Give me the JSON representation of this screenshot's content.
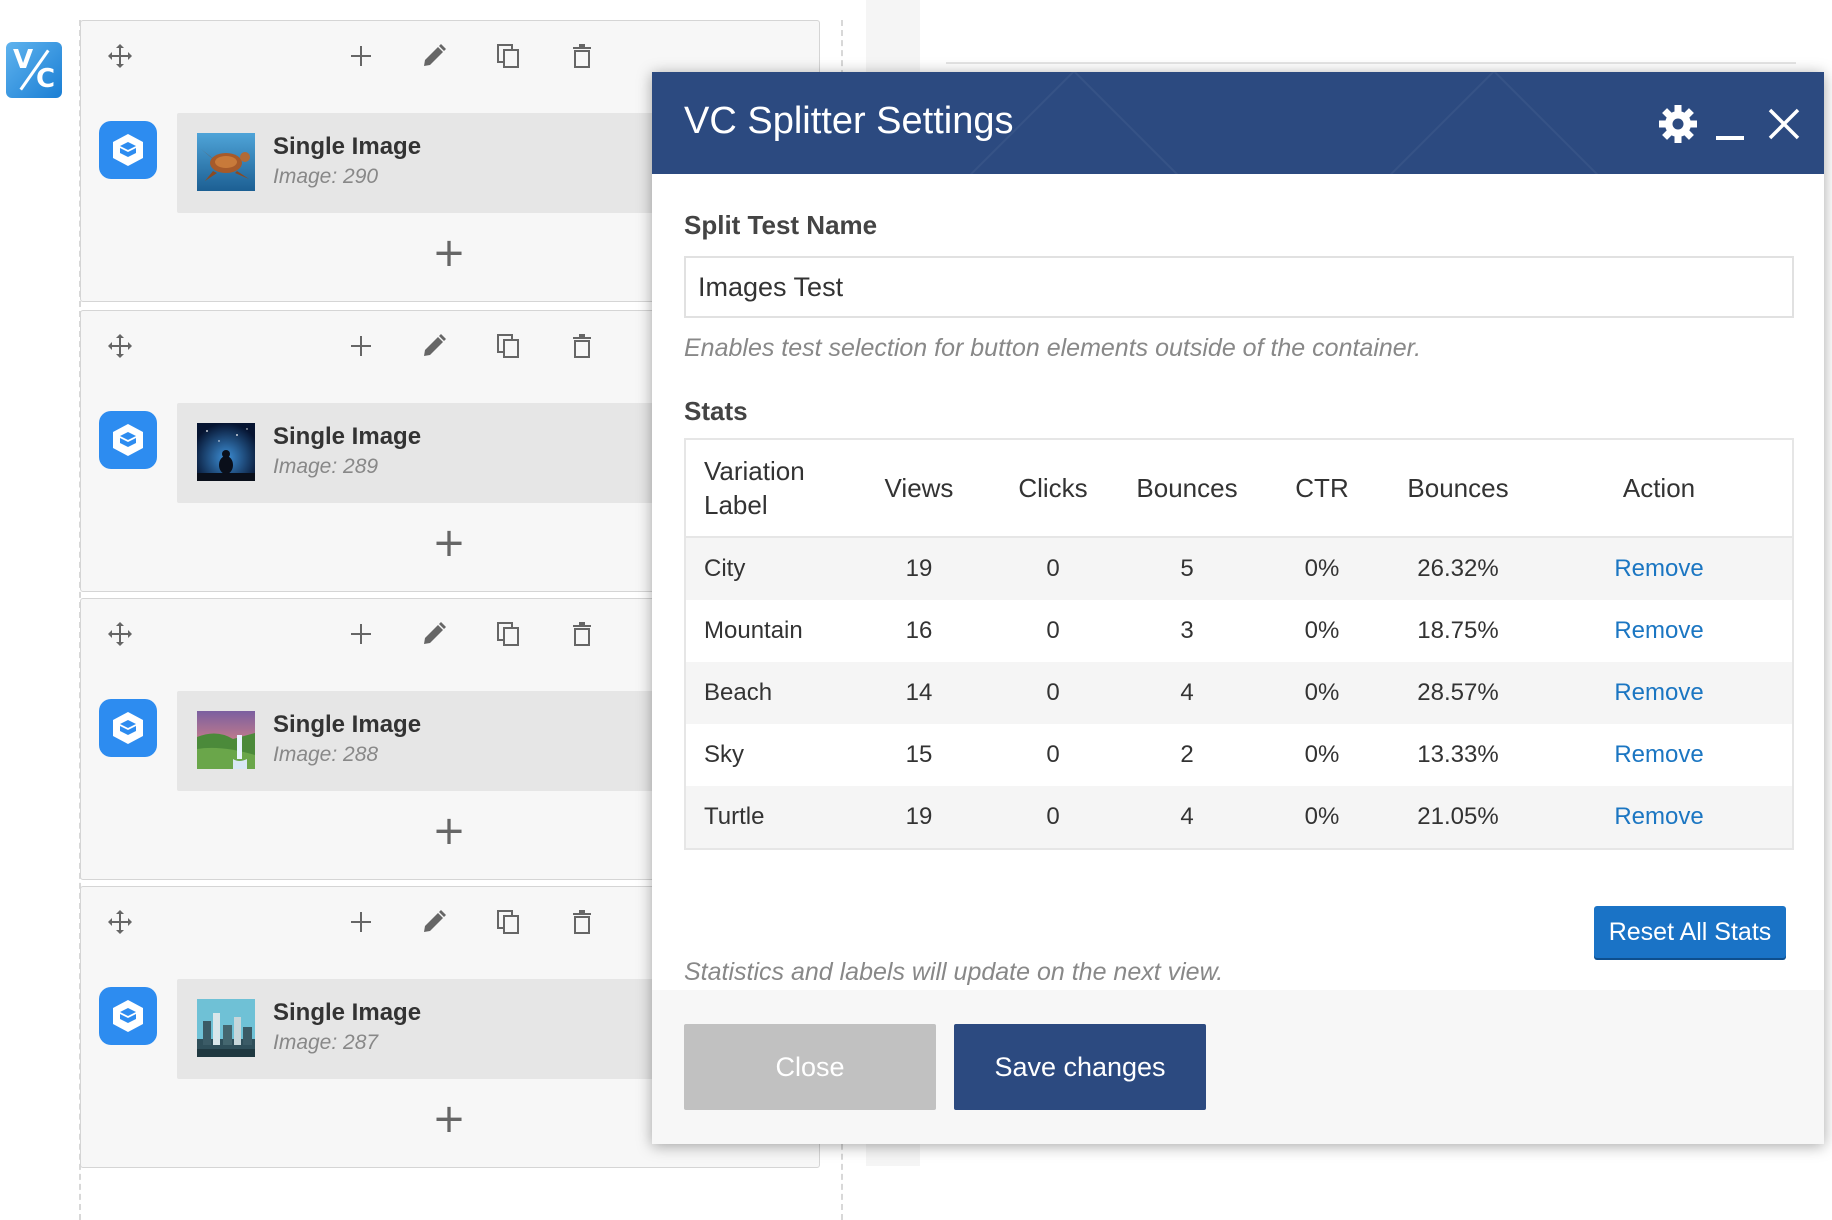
{
  "editor": {
    "elements": [
      {
        "title": "Single Image",
        "subtitle": "Image: 290",
        "thumb": "turtle-image"
      },
      {
        "title": "Single Image",
        "subtitle": "Image: 289",
        "thumb": "night-sky-image"
      },
      {
        "title": "Single Image",
        "subtitle": "Image: 288",
        "thumb": "waterfall-image"
      },
      {
        "title": "Single Image",
        "subtitle": "Image: 287",
        "thumb": "city-image"
      }
    ]
  },
  "modal": {
    "title": "VC Splitter Settings",
    "split_test_name_label": "Split Test Name",
    "split_test_name_value": "Images Test",
    "help_text": "Enables test selection for button elements outside of the container.",
    "stats_label": "Stats",
    "table": {
      "headers": [
        "Variation Label",
        "Views",
        "Clicks",
        "Bounces",
        "CTR",
        "Bounces",
        "Action"
      ],
      "rows": [
        {
          "label": "City",
          "views": "19",
          "clicks": "0",
          "bounces": "5",
          "ctr": "0%",
          "bounce_rate": "26.32%",
          "action": "Remove"
        },
        {
          "label": "Mountain",
          "views": "16",
          "clicks": "0",
          "bounces": "3",
          "ctr": "0%",
          "bounce_rate": "18.75%",
          "action": "Remove"
        },
        {
          "label": "Beach",
          "views": "14",
          "clicks": "0",
          "bounces": "4",
          "ctr": "0%",
          "bounce_rate": "28.57%",
          "action": "Remove"
        },
        {
          "label": "Sky",
          "views": "15",
          "clicks": "0",
          "bounces": "2",
          "ctr": "0%",
          "bounce_rate": "13.33%",
          "action": "Remove"
        },
        {
          "label": "Turtle",
          "views": "19",
          "clicks": "0",
          "bounces": "4",
          "ctr": "0%",
          "bounce_rate": "21.05%",
          "action": "Remove"
        }
      ]
    },
    "reset_label": "Reset All Stats",
    "update_note": "Statistics and labels will update on the next view.",
    "close_label": "Close",
    "save_label": "Save changes"
  },
  "colors": {
    "header_blue": "#2c4a80",
    "link_blue": "#1b76c2",
    "reset_blue": "#1a73c6",
    "close_grey": "#c1c1c1",
    "element_icon_blue": "#2d8cf0"
  }
}
